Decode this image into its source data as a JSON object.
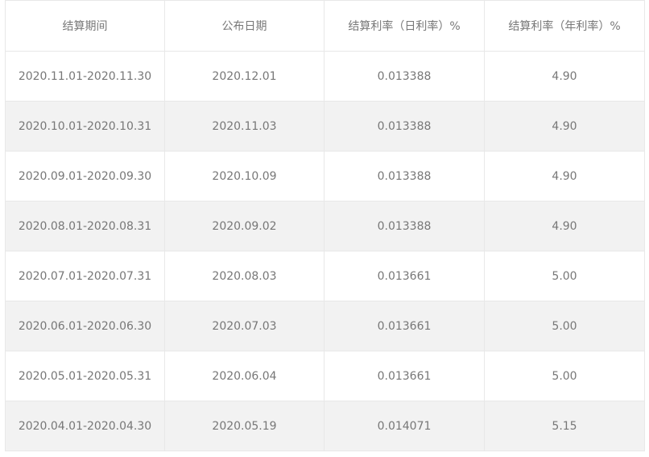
{
  "table": {
    "headers": [
      "结算期间",
      "公布日期",
      "结算利率（日利率）%",
      "结算利率（年利率）%"
    ],
    "rows": [
      [
        "2020.11.01-2020.11.30",
        "2020.12.01",
        "0.013388",
        "4.90"
      ],
      [
        "2020.10.01-2020.10.31",
        "2020.11.03",
        "0.013388",
        "4.90"
      ],
      [
        "2020.09.01-2020.09.30",
        "2020.10.09",
        "0.013388",
        "4.90"
      ],
      [
        "2020.08.01-2020.08.31",
        "2020.09.02",
        "0.013388",
        "4.90"
      ],
      [
        "2020.07.01-2020.07.31",
        "2020.08.03",
        "0.013661",
        "5.00"
      ],
      [
        "2020.06.01-2020.06.30",
        "2020.07.03",
        "0.013661",
        "5.00"
      ],
      [
        "2020.05.01-2020.05.31",
        "2020.06.04",
        "0.013661",
        "5.00"
      ],
      [
        "2020.04.01-2020.04.30",
        "2020.05.19",
        "0.014071",
        "5.15"
      ]
    ]
  },
  "colors": {
    "text": "#777777",
    "border": "#e8e8e8",
    "row_alt_bg": "#f2f2f2",
    "row_bg": "#ffffff"
  }
}
